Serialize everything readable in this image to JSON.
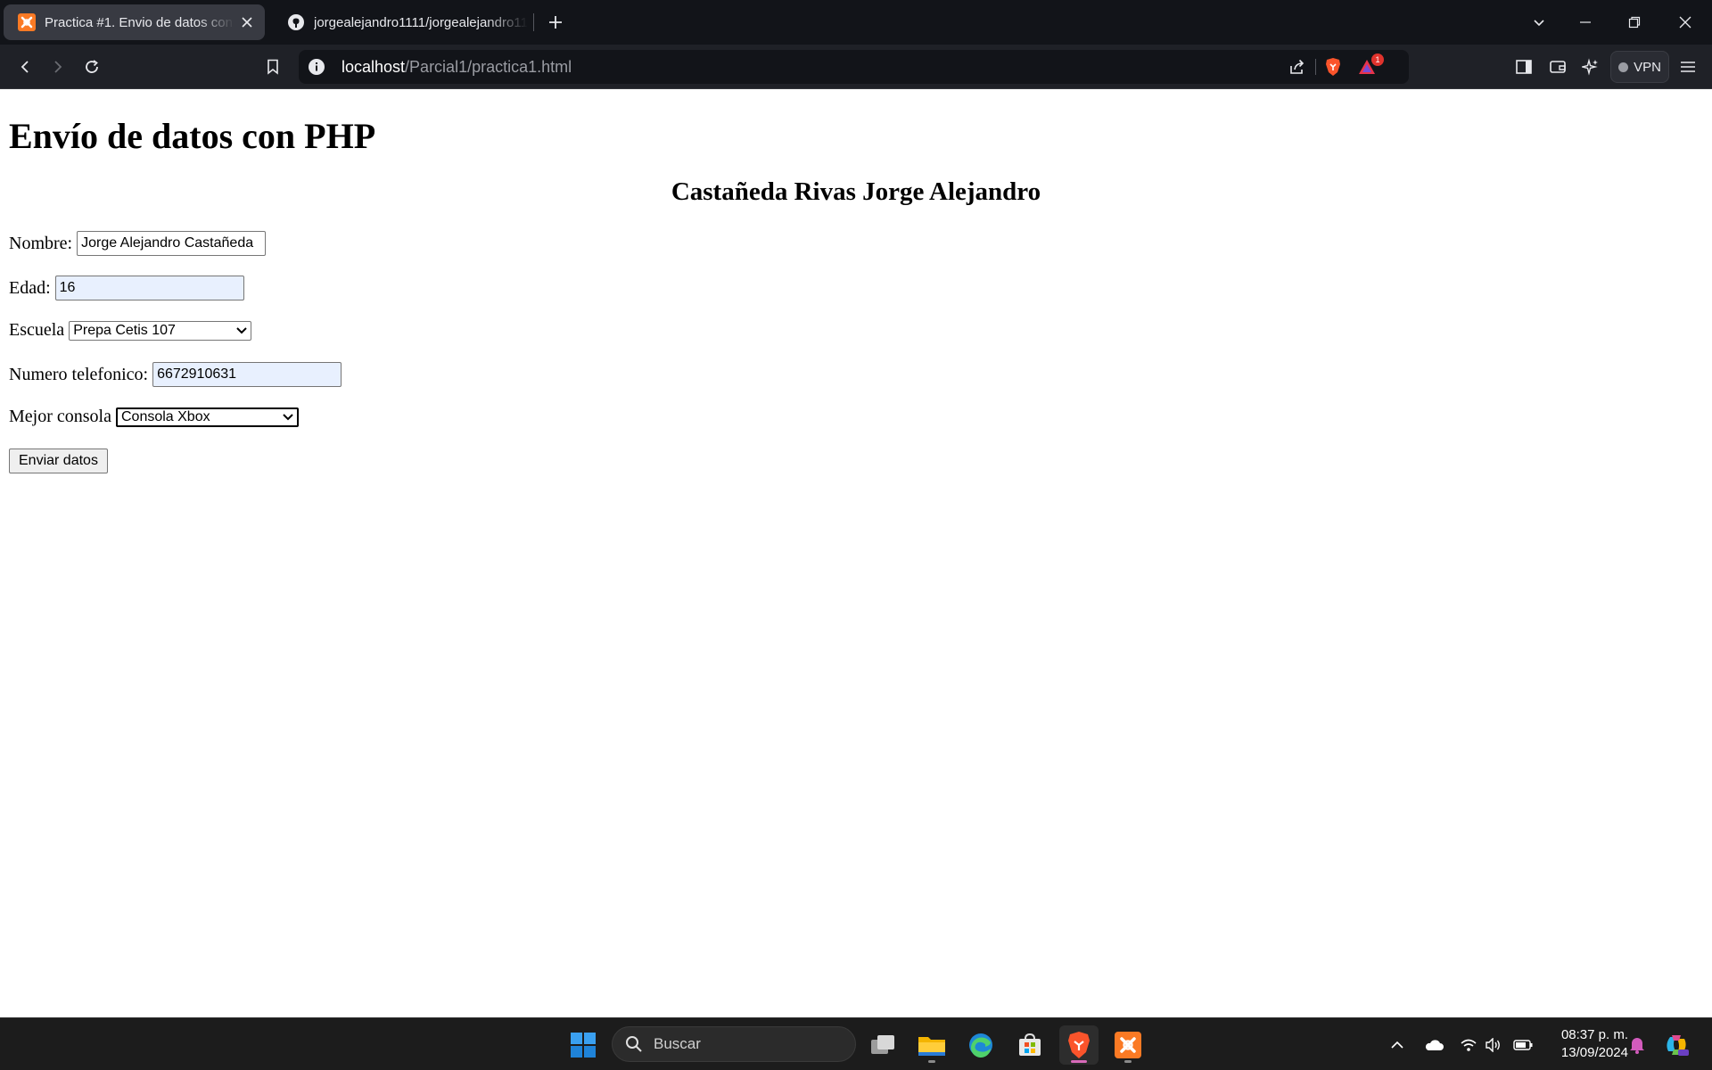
{
  "browser": {
    "tabs": [
      {
        "title": "Practica #1. Envio de datos con PHP",
        "active": true,
        "favicon": "xampp-icon"
      },
      {
        "title": "jorgealejandro1111/jorgealejandro1111",
        "active": false,
        "favicon": "github-icon"
      }
    ],
    "address": {
      "host": "localhost",
      "path": "/Parcial1/practica1.html"
    },
    "notification_count": "1",
    "vpn_label": "VPN"
  },
  "page": {
    "heading": "Envío de datos con PHP",
    "author": "Castañeda Rivas Jorge Alejandro",
    "form": {
      "nombre_label": "Nombre:",
      "nombre_value": "Jorge Alejandro Castañeda",
      "edad_label": "Edad:",
      "edad_value": "16",
      "escuela_label": "Escuela",
      "escuela_selected": "Prepa Cetis 107",
      "telefono_label": "Numero telefonico:",
      "telefono_value": "6672910631",
      "consola_label": "Mejor consola",
      "consola_selected": "Consola Xbox",
      "submit_label": "Enviar datos"
    }
  },
  "taskbar": {
    "search_placeholder": "Buscar",
    "time": "08:37 p. m.",
    "date": "13/09/2024",
    "accent": "#0078d4"
  },
  "colors": {
    "brave_orange": "#fb542b",
    "xampp_orange": "#fb7a24",
    "autofill_bg": "#e8f0fe"
  }
}
